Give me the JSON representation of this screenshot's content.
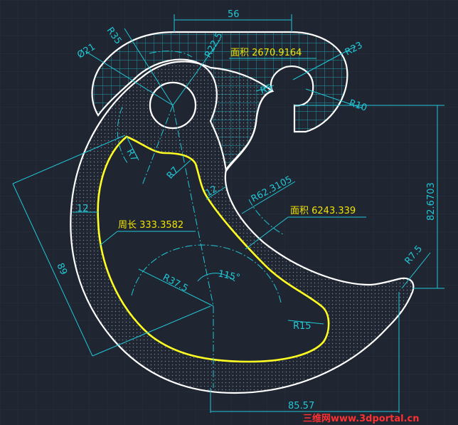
{
  "colors": {
    "background": "#1f2531",
    "grid": "#2c3444",
    "outline": "#ffffff",
    "dimension": "#22c7d6",
    "annotation": "#f2e400",
    "highlight": "#ffff22",
    "watermark": "#ff3030"
  },
  "dimensions": {
    "top_width": "56",
    "r35": "R35",
    "d21": "Ø21",
    "r22_5": "R22.5",
    "r23": "R23",
    "r5": "R5",
    "r10": "R10",
    "r7_a": "R7",
    "r7_b": "R7",
    "r62": "R62.3105",
    "thick_a": "12",
    "thick_b": "12",
    "height_right": "82.6703",
    "len_89": "89",
    "r37_5": "R37.5",
    "angle_115": "115°",
    "r15": "R15",
    "r7_5": "R7.5",
    "bottom_width": "85.57"
  },
  "annotations": {
    "area_top": "面积  2670.9164",
    "area_main": "面积  6243.339",
    "perimeter": "周长  333.3582"
  },
  "watermark": "三维网www.3dportal.cn"
}
